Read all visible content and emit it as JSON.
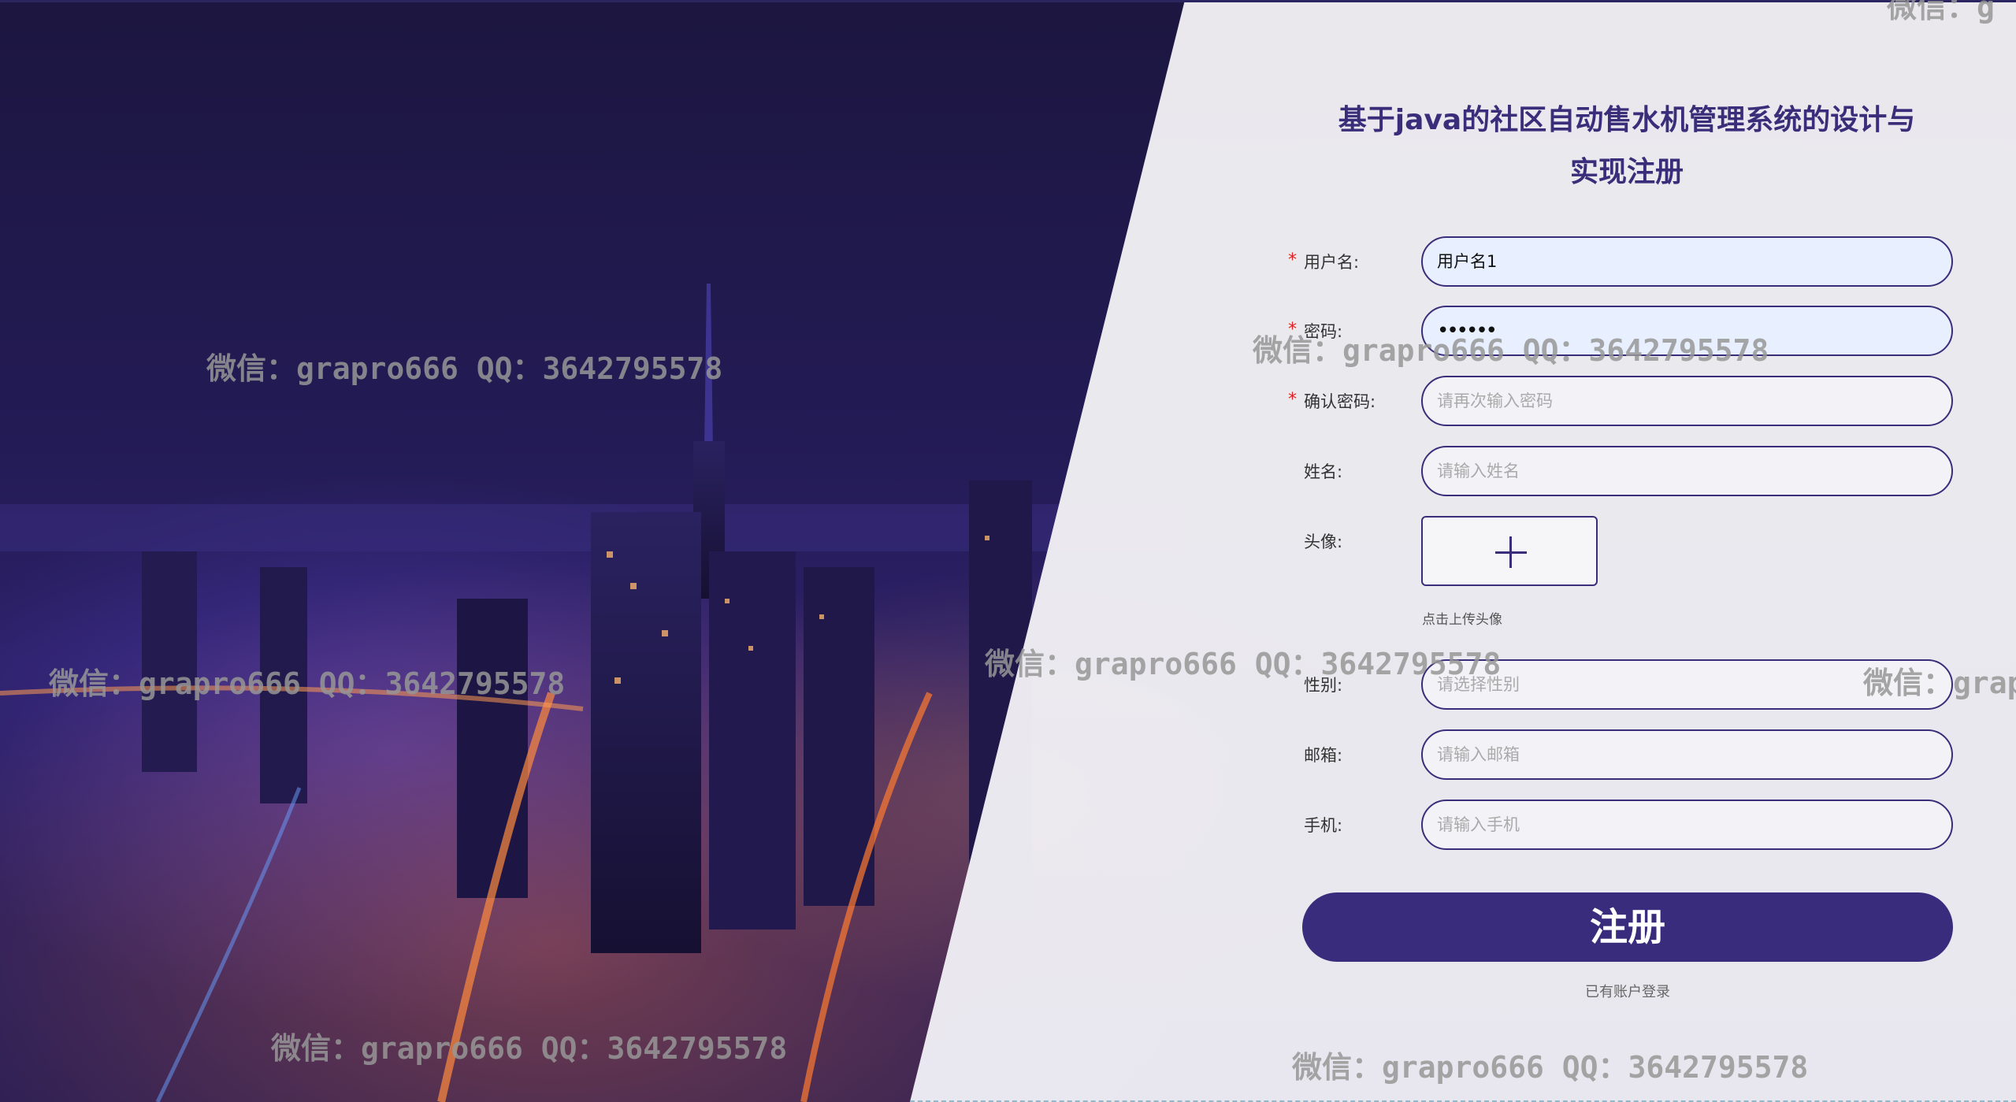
{
  "form": {
    "title_line1": "基于java的社区自动售水机管理系统的设计与",
    "title_line2": "实现注册",
    "required_mark": "*",
    "fields": [
      {
        "label": "用户名:",
        "value": "用户名1",
        "placeholder": ""
      },
      {
        "label": "密码:",
        "value": "••••••",
        "placeholder": ""
      },
      {
        "label": "确认密码:",
        "value": "",
        "placeholder": "请再次输入密码"
      },
      {
        "label": "姓名:",
        "value": "",
        "placeholder": "请输入姓名"
      },
      {
        "label": "头像:"
      },
      {
        "label": "性别:",
        "value": "",
        "placeholder": "请选择性别"
      },
      {
        "label": "邮箱:",
        "value": "",
        "placeholder": "请输入邮箱"
      },
      {
        "label": "手机:",
        "value": "",
        "placeholder": "请输入手机"
      }
    ],
    "upload_hint": "点击上传头像",
    "submit_label": "注册",
    "login_link": "已有账户登录"
  },
  "watermarks": [
    "微信：grapro666 QQ：3642795578",
    "微信：grapro666 QQ：3642795578",
    "微信：grapro666 QQ：3642795578",
    "微信：grapro666 QQ：3642795578",
    "微信：grapro666 QQ：3642795578",
    "微信：grapro666 QQ：3642795578",
    "微信：grap",
    "微信：g"
  ],
  "colors": {
    "accent": "#3a2c7c",
    "required": "#e02020",
    "panel": "#f2f1f5"
  }
}
